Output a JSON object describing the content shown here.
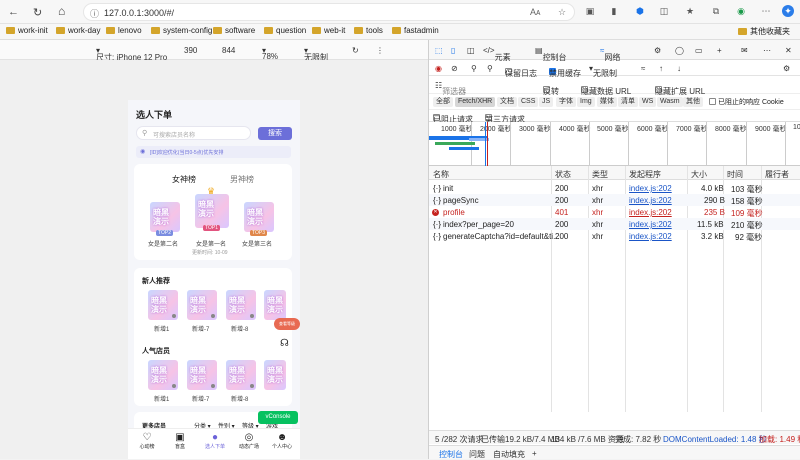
{
  "browser": {
    "url": "127.0.0.1:3000/#/",
    "reader_label": "Aᴀ"
  },
  "bookmarks": [
    "work-init",
    "work-day",
    "lenovo",
    "system-config",
    "software",
    "question",
    "web-it",
    "tools",
    "fastadmin"
  ],
  "other_bookmarks": "其他收藏夹",
  "device_toolbar": {
    "dimensions_label": "尺寸: iPhone 12 Pro",
    "width": "390",
    "height": "844",
    "zoom": "78%",
    "throttle": "无限制"
  },
  "app": {
    "page_title": "选人下单",
    "search_placeholder": "可搜索店员名称",
    "search_button": "搜索",
    "notice_text": "[ID]欢迎优化(当日0-5点)优先安排",
    "ranking_tabs": [
      "女神榜",
      "男神榜"
    ],
    "podium": [
      {
        "badge": "TOP2",
        "label": "女是第二名"
      },
      {
        "badge": "TOP1",
        "label": "女是第一名"
      },
      {
        "badge": "TOP3",
        "label": "女是第三名"
      }
    ],
    "update_time": "更新时间: 10-09",
    "sections": [
      {
        "title": "新人推荐",
        "items": [
          "新增1",
          "新增-7",
          "新增-8",
          ""
        ]
      },
      {
        "title": "人气店员",
        "items": [
          "新增1",
          "新增-7",
          "新增-8",
          ""
        ]
      }
    ],
    "thumb_text": "暗黑\n演示",
    "badge_float": "查看等级",
    "more_section": "更多店员",
    "filters": [
      "分类",
      "性别",
      "等级",
      "游戏"
    ],
    "vconsole": "vConsole",
    "tabbar": [
      {
        "icon": "heart-icon",
        "label": "心动榜"
      },
      {
        "icon": "box-icon",
        "label": "盲盒"
      },
      {
        "icon": "order-icon",
        "label": "选人下单"
      },
      {
        "icon": "plaza-icon",
        "label": "动态广场"
      },
      {
        "icon": "user-icon",
        "label": "个人中心"
      }
    ]
  },
  "devtools": {
    "tabs": [
      "元素",
      "控制台",
      "网络"
    ],
    "toolbar": {
      "preserve_log": "保留日志",
      "disable_cache": "禁用缓存",
      "throttle": "无限制"
    },
    "filter": {
      "placeholder": "筛选器",
      "invert": "反转",
      "hide_data_urls": "隐藏数据 URL",
      "hide_extension_urls": "隐藏扩展 URL"
    },
    "type_filters": [
      "全部",
      "Fetch/XHR",
      "文档",
      "CSS",
      "JS",
      "字体",
      "Img",
      "媒体",
      "清单",
      "WS",
      "Wasm",
      "其他"
    ],
    "blocked_response_cookies": "已阻止的响应 Cookie",
    "blocked_requests": "已阻止请求",
    "third_party": "第三方请求",
    "timeline_ticks": [
      "1000 毫秒",
      "2000 毫秒",
      "3000 毫秒",
      "4000 毫秒",
      "5000 毫秒",
      "6000 毫秒",
      "7000 毫秒",
      "8000 毫秒",
      "9000 毫秒",
      "10"
    ],
    "columns": [
      "名称",
      "状态",
      "类型",
      "发起程序",
      "大小",
      "时间",
      "履行者"
    ],
    "rows": [
      {
        "name": "init",
        "status": "200",
        "type": "xhr",
        "initiator": "index.js:202",
        "size": "4.0 kB",
        "time": "103 毫秒",
        "error": false
      },
      {
        "name": "pageSync",
        "status": "200",
        "type": "xhr",
        "initiator": "index.js:202",
        "size": "290 B",
        "time": "158 毫秒",
        "error": false
      },
      {
        "name": "profile",
        "status": "401",
        "type": "xhr",
        "initiator": "index.js:202",
        "size": "235 B",
        "time": "109 毫秒",
        "error": true
      },
      {
        "name": "index?per_page=20",
        "status": "200",
        "type": "xhr",
        "initiator": "index.js:202",
        "size": "11.5 kB",
        "time": "210 毫秒",
        "error": false
      },
      {
        "name": "generateCaptcha?id=default&ti...",
        "status": "200",
        "type": "xhr",
        "initiator": "index.js:202",
        "size": "3.2 kB",
        "time": "92 毫秒",
        "error": false
      }
    ],
    "summary": {
      "requests": "5 /282 次请求",
      "transferred": "已传输19.2 kB/7.4 MB",
      "resources": "134 kB /7.6 MB 资源",
      "finish": "完成: 7.82 秒",
      "dcl": "DOMContentLoaded: 1.48 秒",
      "load": "加载: 1.49 秒"
    },
    "drawer_tabs": [
      "控制台",
      "问题",
      "自动填充"
    ]
  },
  "colors": {
    "accent": "#1a73e8",
    "purple": "#6c63d9",
    "error": "#c5221f",
    "vconsole": "#07c160"
  }
}
